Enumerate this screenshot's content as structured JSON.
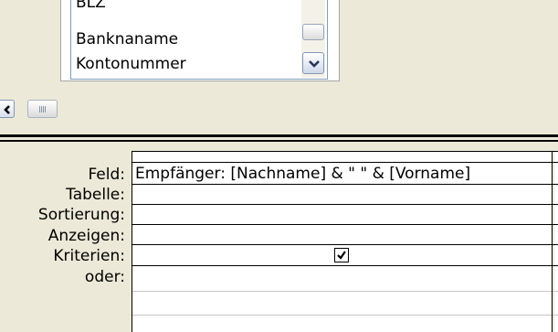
{
  "field_list": {
    "items": [
      "BLZ",
      "Banknaname",
      "Kontonummer"
    ]
  },
  "grid": {
    "row_labels": [
      "Feld:",
      "Tabelle:",
      "Sortierung:",
      "Anzeigen:",
      "Kriterien:",
      "oder:"
    ],
    "column1": {
      "feld": "Empfänger: [Nachname] & \" \" & [Vorname]",
      "tabelle": "",
      "sortierung": "",
      "anzeigen_checked": true,
      "kriterien": "",
      "oder": ""
    }
  },
  "icons": {
    "list_down": "chevron-down-icon",
    "hscroll_left": "chevron-left-icon",
    "checkbox": "checkmark-icon"
  }
}
